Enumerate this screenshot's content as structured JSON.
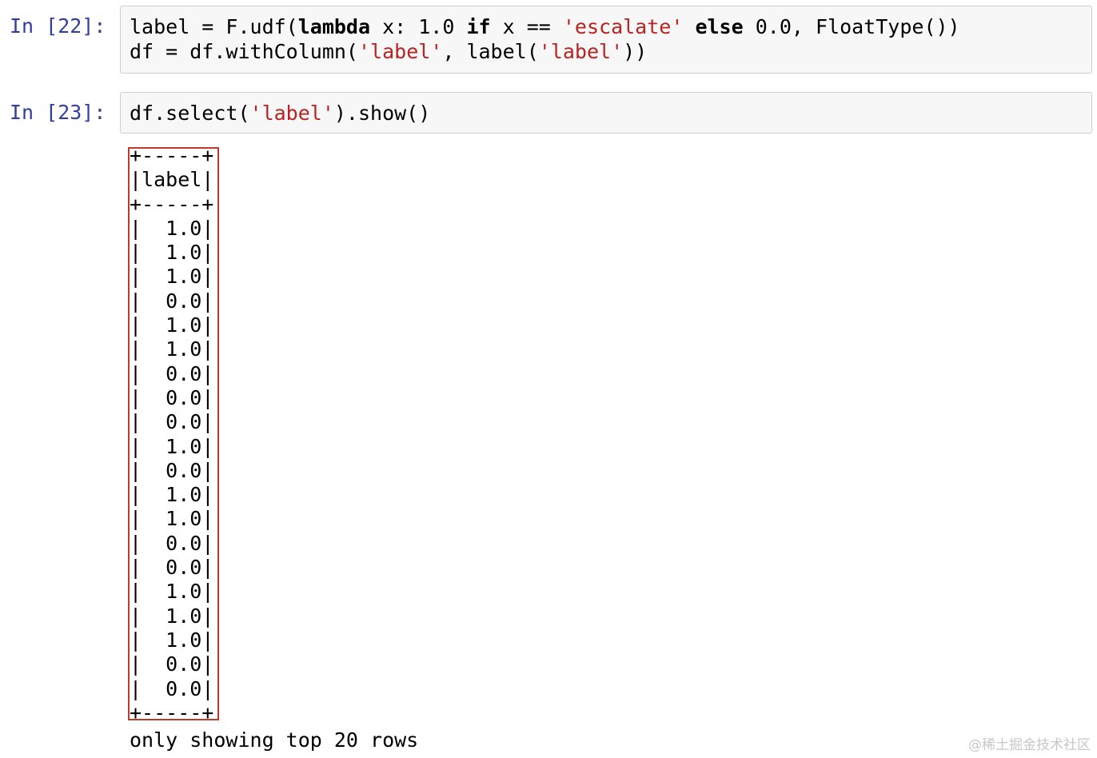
{
  "cells": [
    {
      "prompt": "In [22]:",
      "lines": [
        {
          "tokens": [
            {
              "t": "label = F.udf(",
              "c": "op"
            },
            {
              "t": "lambda",
              "c": "kw"
            },
            {
              "t": " x: 1.0 ",
              "c": "op"
            },
            {
              "t": "if",
              "c": "kw"
            },
            {
              "t": " x == ",
              "c": "op"
            },
            {
              "t": "'escalate'",
              "c": "str"
            },
            {
              "t": " ",
              "c": "op"
            },
            {
              "t": "else",
              "c": "kw"
            },
            {
              "t": " 0.0, FloatType())",
              "c": "op"
            }
          ]
        },
        {
          "tokens": [
            {
              "t": "df = df.withColumn(",
              "c": "op"
            },
            {
              "t": "'label'",
              "c": "str"
            },
            {
              "t": ", label(",
              "c": "op"
            },
            {
              "t": "'label'",
              "c": "str"
            },
            {
              "t": "))",
              "c": "op"
            }
          ]
        }
      ]
    },
    {
      "prompt": "In [23]:",
      "lines": [
        {
          "tokens": [
            {
              "t": "df.select(",
              "c": "op"
            },
            {
              "t": "'label'",
              "c": "str"
            },
            {
              "t": ").show()",
              "c": "op"
            }
          ]
        }
      ]
    }
  ],
  "output": {
    "border_line": "+-----+",
    "header": "|label|",
    "rows": [
      "1.0",
      "1.0",
      "1.0",
      "0.0",
      "1.0",
      "1.0",
      "0.0",
      "0.0",
      "0.0",
      "1.0",
      "0.0",
      "1.0",
      "1.0",
      "0.0",
      "0.0",
      "1.0",
      "1.0",
      "1.0",
      "0.0",
      "0.0"
    ],
    "footer": "only showing top 20 rows"
  },
  "watermark": "@稀土掘金技术社区",
  "colors": {
    "prompt": "#303F9F",
    "string": "#BA2121",
    "highlight": "#c0392b",
    "cell_bg": "#f7f7f7",
    "cell_border": "#cfcfcf"
  }
}
